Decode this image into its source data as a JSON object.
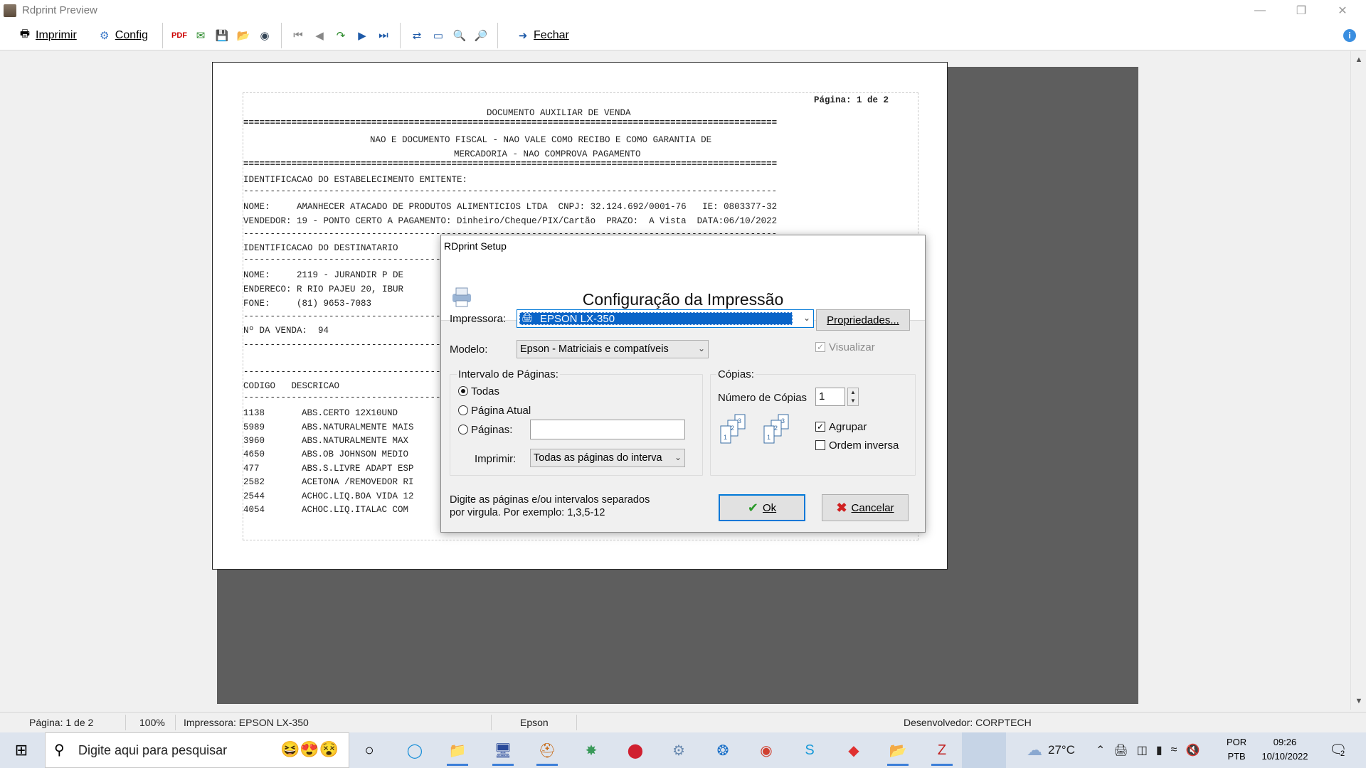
{
  "window": {
    "title": "Rdprint Preview"
  },
  "toolbar": {
    "print_label": "Imprimir",
    "config_label": "Config",
    "close_label": "Fechar"
  },
  "document": {
    "page_label": "Página: 1 de 2",
    "title": "DOCUMENTO AUXILIAR DE VENDA",
    "sep_eq": "====================================================================================================",
    "sep_dash": "----------------------------------------------------------------------------------------------------",
    "notice1": "NAO E DOCUMENTO FISCAL - NAO VALE COMO RECIBO E COMO GARANTIA DE",
    "notice2": "MERCADORIA - NAO COMPROVA PAGAMENTO",
    "emit_header": "IDENTIFICACAO DO ESTABELECIMENTO EMITENTE:",
    "emit_name": "NOME:     AMANHECER ATACADO DE PRODUTOS ALIMENTICIOS LTDA  CNPJ: 32.124.692/0001-76   IE: 0803377-32",
    "emit_seller": "VENDEDOR: 19 - PONTO CERTO A PAGAMENTO: Dinheiro/Cheque/PIX/Cartão  PRAZO:  A Vista  DATA:06/10/2022",
    "dest_header": "IDENTIFICACAO DO DESTINATARIO",
    "dest_name": "NOME:     2119 - JURANDIR P DE",
    "dest_addr": "ENDERECO: R RIO PAJEU 20, IBUR",
    "dest_phone": "FONE:     (81) 9653-7083",
    "sale_no": "Nº DA VENDA:  94",
    "cols": "CODIGO   DESCRICAO",
    "items": [
      {
        "code": "1138",
        "desc": "ABS.CERTO 12X10UND"
      },
      {
        "code": "5989",
        "desc": "ABS.NATURALMENTE MAIS"
      },
      {
        "code": "3960",
        "desc": "ABS.NATURALMENTE MAX"
      },
      {
        "code": "4650",
        "desc": "ABS.OB JOHNSON MEDIO"
      },
      {
        "code": "477",
        "desc": "ABS.S.LIVRE ADAPT ESP"
      },
      {
        "code": "2582",
        "desc": "ACETONA /REMOVEDOR RI"
      },
      {
        "code": "2544",
        "desc": "ACHOC.LIQ.BOA VIDA 12"
      },
      {
        "code": "4054",
        "desc": "ACHOC.LIQ.ITALAC COM"
      }
    ]
  },
  "dialog": {
    "title": "RDprint Setup",
    "heading": "Configuração da Impressão",
    "printer_label": "Impressora:",
    "printer_value": "EPSON LX-350",
    "properties_label": "Propriedades...",
    "model_label": "Modelo:",
    "model_value": "Epson - Matriciais e compatíveis",
    "visualizar_label": "Visualizar",
    "range_group": "Intervalo de Páginas:",
    "opt_all": "Todas",
    "opt_current": "Página Atual",
    "opt_pages": "Páginas:",
    "print_label": "Imprimir:",
    "print_value": "Todas as páginas do interva",
    "copies_group": "Cópias:",
    "copies_label": "Número de Cópias",
    "copies_value": "1",
    "collate_label": "Agrupar",
    "reverse_label": "Ordem inversa",
    "hint1": "Digite as páginas e/ou intervalos separados",
    "hint2": "por virgula.  Por exemplo: 1,3,5-12",
    "ok_label": "Ok",
    "cancel_label": "Cancelar"
  },
  "statusbar": {
    "page": "Página: 1 de 2",
    "zoom": "100%",
    "printer": "Impressora: EPSON LX-350",
    "model": "Epson",
    "developer": "Desenvolvedor: CORPTECH"
  },
  "taskbar": {
    "search_placeholder": "Digite aqui para pesquisar",
    "temperature": "27°C",
    "lang1": "POR",
    "lang2": "PTB",
    "time": "09:26",
    "date": "10/10/2022",
    "notif_count": "2"
  }
}
